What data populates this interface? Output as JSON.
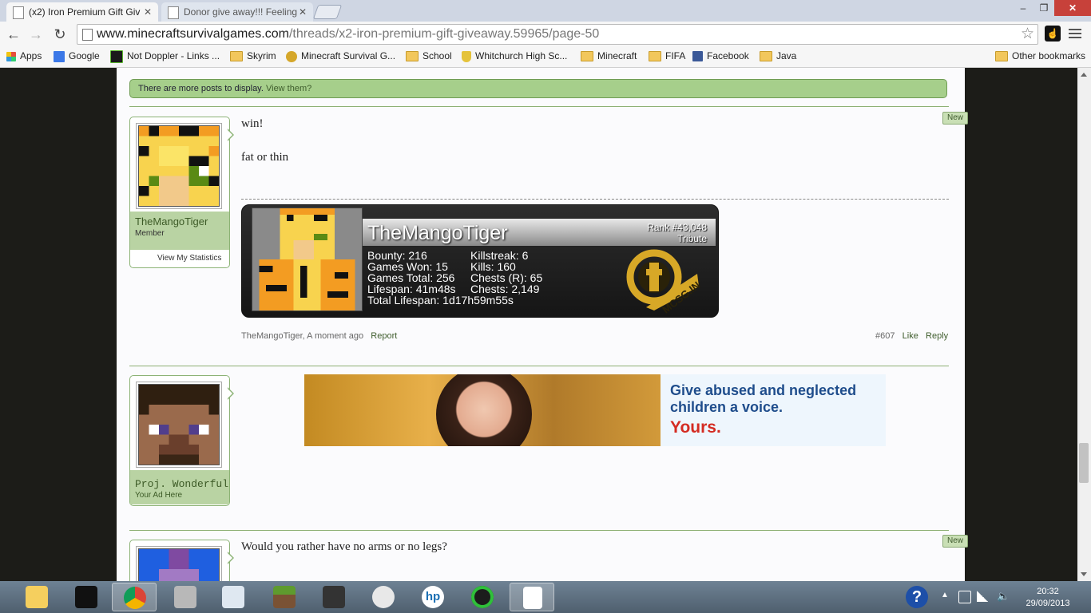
{
  "browser": {
    "tabs": [
      {
        "label": "(x2) Iron Premium Gift Giv",
        "active": true
      },
      {
        "label": "Donor give away!!! Feeling",
        "active": false
      }
    ],
    "window_controls": {
      "minimize": "–",
      "maximize": "❐",
      "close": "✕"
    },
    "url_domain": "www.minecraftsurvivalgames.com",
    "url_path": "/threads/x2-iron-premium-gift-giveaway.59965/page-50",
    "bookmarks": [
      {
        "label": "Apps",
        "icon": "apps-grid-icon"
      },
      {
        "label": "Google",
        "icon": "google-icon"
      },
      {
        "label": "Not Doppler - Links ...",
        "icon": "notdoppler-icon"
      },
      {
        "label": "Skyrim",
        "icon": "folder-icon"
      },
      {
        "label": "Minecraft Survival G...",
        "icon": "mcsg-icon"
      },
      {
        "label": "School",
        "icon": "folder-icon"
      },
      {
        "label": "Whitchurch High Sc...",
        "icon": "school-crest-icon"
      },
      {
        "label": "Minecraft",
        "icon": "folder-icon"
      },
      {
        "label": "FIFA",
        "icon": "folder-icon"
      },
      {
        "label": "Facebook",
        "icon": "facebook-icon"
      },
      {
        "label": "Java",
        "icon": "folder-icon"
      }
    ],
    "other_bookmarks": "Other bookmarks"
  },
  "page": {
    "more_posts_text": "There are more posts to display.",
    "more_posts_link": "View them?",
    "new_badge": "New",
    "post1": {
      "author": "TheMangoTiger",
      "author_title": "Member",
      "view_stats": "View My Statistics",
      "lines": [
        "win!",
        "fat or thin"
      ],
      "meta_author": "TheMangoTiger",
      "meta_time": "A moment ago",
      "report": "Report",
      "post_number": "#607",
      "like": "Like",
      "reply": "Reply",
      "signature": {
        "name": "TheMangoTiger",
        "rank": "Rank #43,048",
        "rank_title": "Tribute",
        "stats_left": [
          "Bounty: 216",
          "Games Won: 15",
          "Games Total: 256",
          "Lifespan: 41m48s",
          "Total Lifespan: 1d17h59m55s"
        ],
        "stats_right": [
          "Killstreak: 6",
          "Kills: 160",
          "Chests (R): 65",
          "Chests: 2,149"
        ],
        "emblem_text": "MCSG.IN"
      }
    },
    "ad_block": {
      "author": "Proj. Wonderful",
      "author_title": "Your Ad Here",
      "headline_1": "Give abused and neglected",
      "headline_2": "children a voice.",
      "tagline": "Yours."
    },
    "post2": {
      "lines": [
        "Would you rather have no arms or no legs?"
      ]
    }
  },
  "taskbar": {
    "time": "20:32",
    "date": "29/09/2013",
    "icons": [
      "file-explorer-icon",
      "touch-icon",
      "chrome-icon",
      "tools-icon",
      "control-panel-icon",
      "minecraft-icon",
      "touch-app-icon",
      "penguin-icon",
      "hp-icon",
      "green-app-icon",
      "document-icon"
    ]
  }
}
